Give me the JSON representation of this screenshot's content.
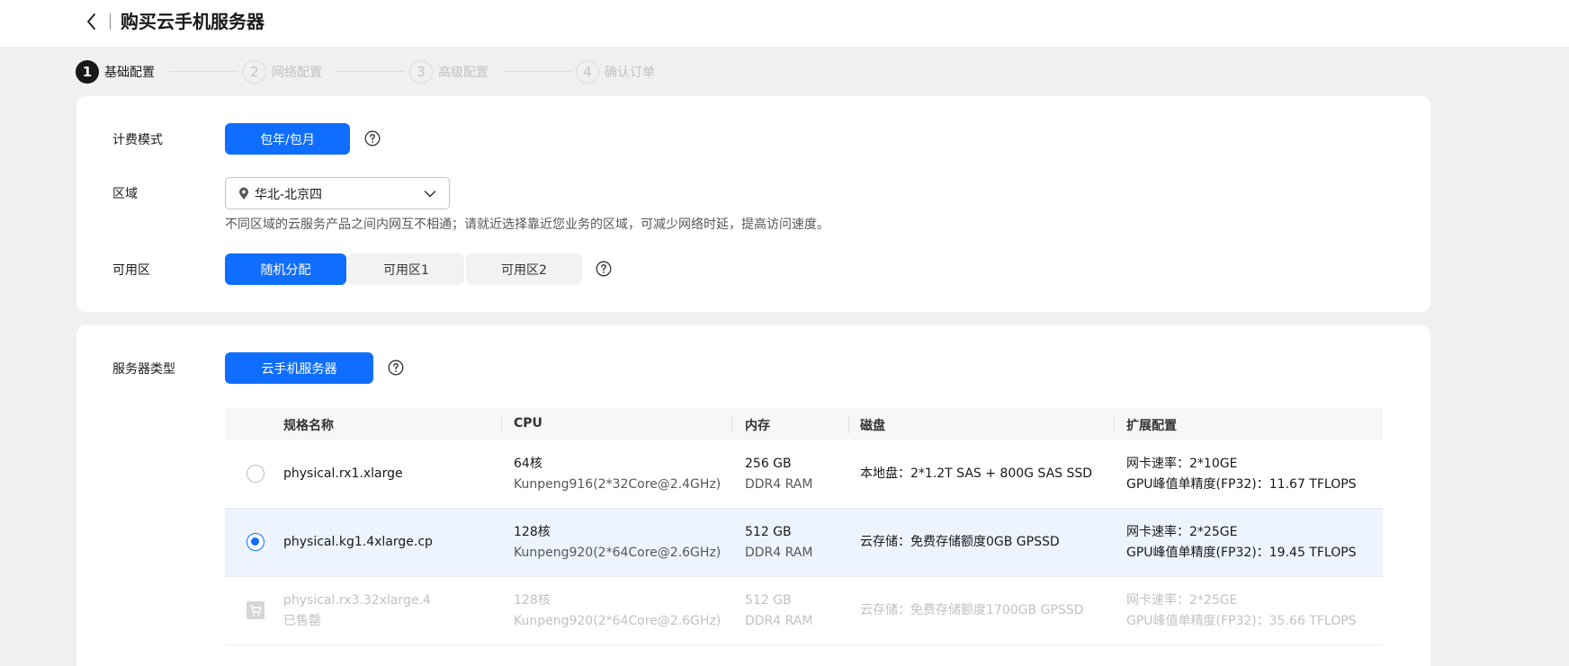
{
  "header": {
    "title": "购买云手机服务器"
  },
  "steps": [
    {
      "num": "1",
      "label": "基础配置"
    },
    {
      "num": "2",
      "label": "网络配置"
    },
    {
      "num": "3",
      "label": "高级配置"
    },
    {
      "num": "4",
      "label": "确认订单"
    }
  ],
  "billing": {
    "label": "计费模式",
    "option": "包年/包月"
  },
  "region": {
    "label": "区域",
    "value": "华北-北京四",
    "hint": "不同区域的云服务产品之间内网互不相通；请就近选择靠近您业务的区域，可减少网络时延，提高访问速度。"
  },
  "az": {
    "label": "可用区",
    "options": [
      "随机分配",
      "可用区1",
      "可用区2"
    ]
  },
  "server_type": {
    "label": "服务器类型",
    "option": "云手机服务器"
  },
  "table": {
    "headers": [
      "规格名称",
      "CPU",
      "内存",
      "磁盘",
      "扩展配置"
    ],
    "rows": [
      {
        "name": "physical.rx1.xlarge",
        "cpu": "64核",
        "cpu_model": "Kunpeng916(2*32Core@2.4GHz)",
        "mem": "256 GB",
        "mem_type": "DDR4 RAM",
        "disk": "本地盘：2*1.2T SAS + 800G SAS SSD",
        "nic": "网卡速率：2*10GE",
        "gpu": "GPU峰值单精度(FP32)：11.67 TFLOPS"
      },
      {
        "name": "physical.kg1.4xlarge.cp",
        "cpu": "128核",
        "cpu_model": "Kunpeng920(2*64Core@2.6GHz)",
        "mem": "512 GB",
        "mem_type": "DDR4 RAM",
        "disk": "云存储：免费存储额度0GB GPSSD",
        "nic": "网卡速率：2*25GE",
        "gpu": "GPU峰值单精度(FP32)：19.45 TFLOPS"
      },
      {
        "name": "physical.rx3.32xlarge.4",
        "status": "已售罄",
        "cpu": "128核",
        "cpu_model": "Kunpeng920(2*64Core@2.6GHz)",
        "mem": "512 GB",
        "mem_type": "DDR4 RAM",
        "disk": "云存储：免费存储额度1700GB GPSSD",
        "nic": "网卡速率：2*25GE",
        "gpu": "GPU峰值单精度(FP32)：35.66 TFLOPS"
      }
    ]
  },
  "colors": {
    "primary": "#0f6eff",
    "selected_row": "#edf4ff",
    "page_bg": "#f0f0f0"
  },
  "icons": {
    "back": "chevron-left-icon",
    "help": "question-circle-icon",
    "location": "map-pin-icon",
    "dropdown": "chevron-down-icon",
    "soldout": "cart-icon"
  }
}
